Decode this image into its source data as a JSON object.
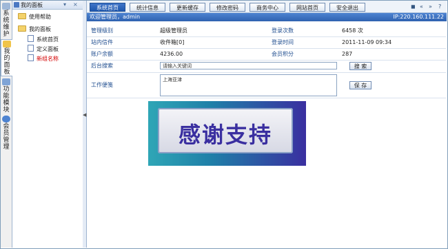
{
  "vtabs": [
    {
      "icon": "computer-icon",
      "label": "系统维护"
    },
    {
      "icon": "home-icon",
      "label": "我的面板"
    },
    {
      "icon": "puzzle-icon",
      "label": "功能模块"
    },
    {
      "icon": "user-icon",
      "label": "会员管理"
    }
  ],
  "sidebar": {
    "title": "我的面板",
    "controls": [
      "▾",
      "×"
    ],
    "items": [
      {
        "label": "使用帮助",
        "type": "folder"
      },
      {
        "label": "我的面板",
        "type": "folder"
      },
      {
        "label": "系统首页",
        "type": "doc"
      },
      {
        "label": "定义面板",
        "type": "doc"
      },
      {
        "label": "新组名称",
        "type": "doc",
        "color": "#d40000"
      }
    ]
  },
  "tabs": [
    "系统首页",
    "统计信息",
    "更新缓存",
    "修改密码",
    "商务中心",
    "网站首页",
    "安全退出"
  ],
  "tab_controls": [
    "◼",
    "«",
    "»",
    "?"
  ],
  "welcome": {
    "left": "欢迎管理员，admin",
    "right": "IP:220.160.111.22"
  },
  "info": [
    {
      "label1": "管理级别",
      "value1": "超级管理员",
      "label2": "登录次数",
      "value2": "6458 次"
    },
    {
      "label1": "站内信件",
      "value1": "收件箱[0]",
      "label2": "登录时间",
      "value2": "2011-11-09 09:34"
    },
    {
      "label1": "账户余额",
      "value1": "4236.00",
      "label2": "会员积分",
      "value2": "287"
    }
  ],
  "search": {
    "label": "后台搜索",
    "placeholder": "请输入关键词",
    "button": "搜 索"
  },
  "memo": {
    "label": "工作便笺",
    "value": "上海亚津",
    "button": "保 存"
  },
  "banner": {
    "text": "感谢支持"
  }
}
